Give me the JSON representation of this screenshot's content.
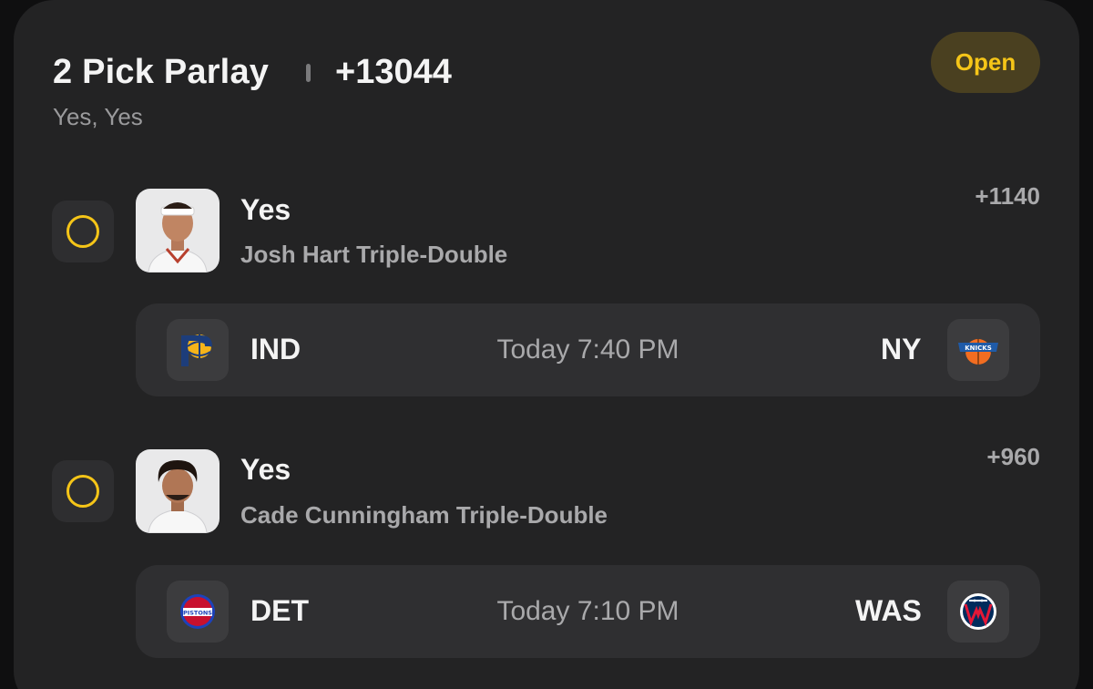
{
  "parlay": {
    "title": "2 Pick Parlay",
    "odds": "+13044",
    "subtitle": "Yes, Yes",
    "status": "Open"
  },
  "picks": [
    {
      "choice": "Yes",
      "market": "Josh Hart Triple-Double",
      "odds": "+1140",
      "player_icon": "player-headshot-icon",
      "game": {
        "away": "IND",
        "away_icon": "pacers-logo-icon",
        "time": "Today 7:40 PM",
        "home": "NY",
        "home_icon": "knicks-logo-icon"
      }
    },
    {
      "choice": "Yes",
      "market": "Cade Cunningham Triple-Double",
      "odds": "+960",
      "player_icon": "player-headshot-icon",
      "game": {
        "away": "DET",
        "away_icon": "pistons-logo-icon",
        "time": "Today 7:10 PM",
        "home": "WAS",
        "home_icon": "wizards-logo-icon"
      }
    }
  ],
  "colors": {
    "accent": "#f5c518",
    "card_bg": "#232324",
    "row_bg": "#2f2f31",
    "muted_text": "#a9a9ab"
  }
}
